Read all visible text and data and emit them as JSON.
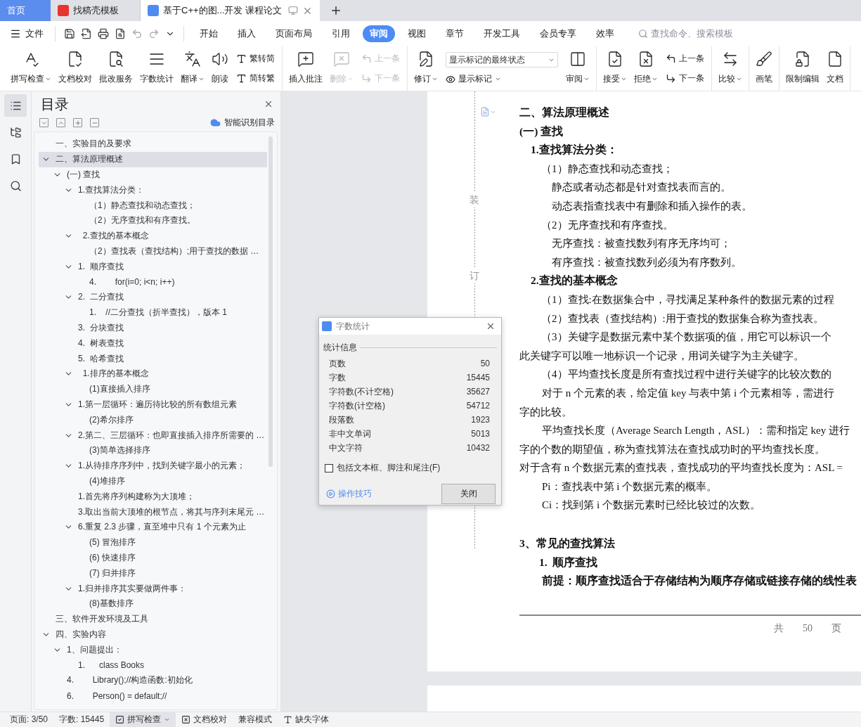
{
  "window_tabs": [
    {
      "label": "首页",
      "kind": "home",
      "selected": false
    },
    {
      "label": "找稿壳模板",
      "kind": "template",
      "selected": false
    },
    {
      "label": "基于C++的图...开发 课程论文",
      "kind": "document",
      "selected": true
    }
  ],
  "menu": {
    "file": "文件",
    "tabs": [
      {
        "label": "开始",
        "selected": false
      },
      {
        "label": "插入",
        "selected": false
      },
      {
        "label": "页面布局",
        "selected": false
      },
      {
        "label": "引用",
        "selected": false
      },
      {
        "label": "审阅",
        "selected": true
      },
      {
        "label": "视图",
        "selected": false
      },
      {
        "label": "章节",
        "selected": false
      },
      {
        "label": "开发工具",
        "selected": false
      },
      {
        "label": "会员专享",
        "selected": false
      },
      {
        "label": "效率",
        "selected": false
      }
    ],
    "search": {
      "placeholder": "查找命令、搜索模板"
    }
  },
  "ribbon": {
    "groups": [
      {
        "tools": [
          {
            "kind": "large",
            "label": "拼写检查",
            "dropdown": true,
            "disabled": false
          },
          {
            "kind": "large",
            "label": "文档校对",
            "dropdown": false,
            "disabled": false
          },
          {
            "kind": "large",
            "label": "批改服务",
            "dropdown": false,
            "disabled": false
          },
          {
            "kind": "large",
            "label": "字数统计",
            "dropdown": false,
            "disabled": false
          },
          {
            "kind": "large",
            "label": "翻译",
            "dropdown": true,
            "disabled": false
          },
          {
            "kind": "large",
            "label": "朗读",
            "dropdown": false,
            "disabled": false
          },
          {
            "kind": "pair",
            "items": [
              {
                "label": "繁转简",
                "disabled": false
              },
              {
                "label": "简转繁",
                "disabled": false
              }
            ]
          }
        ]
      },
      {
        "tools": [
          {
            "kind": "large",
            "label": "插入批注",
            "dropdown": false,
            "disabled": false
          },
          {
            "kind": "large",
            "label": "删除",
            "dropdown": true,
            "disabled": true
          },
          {
            "kind": "pair",
            "items": [
              {
                "label": "上一条",
                "disabled": true
              },
              {
                "label": "下一条",
                "disabled": true
              }
            ]
          }
        ]
      },
      {
        "tools": [
          {
            "kind": "large",
            "label": "修订",
            "dropdown": true,
            "disabled": false
          },
          {
            "kind": "select",
            "value": "显示标记的最终状态",
            "label": "显示标记",
            "dropdown": true
          },
          {
            "kind": "large",
            "label": "审阅",
            "dropdown": true,
            "disabled": false
          }
        ]
      },
      {
        "tools": [
          {
            "kind": "large",
            "label": "接受",
            "dropdown": true,
            "disabled": false
          },
          {
            "kind": "large",
            "label": "拒绝",
            "dropdown": true,
            "disabled": false
          },
          {
            "kind": "pair",
            "items": [
              {
                "label": "上一条",
                "disabled": false
              },
              {
                "label": "下一条",
                "disabled": false
              }
            ]
          }
        ]
      },
      {
        "tools": [
          {
            "kind": "large",
            "label": "比较",
            "dropdown": true,
            "disabled": false
          }
        ]
      },
      {
        "tools": [
          {
            "kind": "large",
            "label": "画笔",
            "dropdown": false,
            "disabled": false
          }
        ]
      },
      {
        "tools": [
          {
            "kind": "large",
            "label": "限制编辑",
            "dropdown": false,
            "disabled": false
          },
          {
            "kind": "large",
            "label": "文档",
            "dropdown": false,
            "disabled": false
          }
        ]
      }
    ]
  },
  "side_rail": [
    {
      "selected": true
    },
    {
      "selected": false
    },
    {
      "selected": false
    },
    {
      "selected": false
    }
  ],
  "toc": {
    "title": "目录",
    "smart_button": "智能识别目录",
    "items": [
      {
        "text": "一、实验目的及要求",
        "selected": false
      },
      {
        "text": "二、算法原理概述",
        "selected": true,
        "expanded": true,
        "children": [
          {
            "text": "(一) 查找",
            "selected": false,
            "expanded": true,
            "children": [
              {
                "text": "1.查找算法分类：",
                "selected": false,
                "expanded": true,
                "children": [
                  {
                    "text": "（1）静态查找和动态查找；",
                    "selected": false
                  },
                  {
                    "text": "（2）无序查找和有序查找。",
                    "selected": false
                  }
                ]
              },
              {
                "text": "  2.查找的基本概念",
                "selected": false,
                "expanded": true,
                "children": [
                  {
                    "text": "（2）查找表（查找结构）;用于查找的数据 …",
                    "selected": false
                  }
                ]
              },
              {
                "text": "1.  顺序查找",
                "selected": false,
                "expanded": true,
                "children": [
                  {
                    "text": "4.        for(i=0; i<n; i++)",
                    "selected": false
                  }
                ]
              },
              {
                "text": "2.  二分查找",
                "selected": false,
                "expanded": true,
                "children": [
                  {
                    "text": "1.    //二分查找（折半查找），版本 1",
                    "selected": false
                  }
                ]
              },
              {
                "text": "3.  分块查找",
                "selected": false
              },
              {
                "text": "4.  树表查找",
                "selected": false
              },
              {
                "text": "5.  哈希查找",
                "selected": false
              },
              {
                "text": "  1.排序的基本概念",
                "selected": false,
                "expanded": true,
                "children": [
                  {
                    "text": "(1)直接插入排序",
                    "selected": false
                  }
                ]
              },
              {
                "text": "1.第一层循环：遍历待比较的所有数组元素",
                "selected": false,
                "expanded": true,
                "children": [
                  {
                    "text": "(2)希尔排序",
                    "selected": false
                  }
                ]
              },
              {
                "text": "2.第二、三层循环：也即直接插入排序所需要的 …",
                "selected": false,
                "expanded": true,
                "children": [
                  {
                    "text": "(3)简单选择排序",
                    "selected": false
                  }
                ]
              },
              {
                "text": "1.从待排序序列中，找到关键字最小的元素；",
                "selected": false,
                "expanded": true,
                "children": [
                  {
                    "text": "(4)堆排序",
                    "selected": false
                  }
                ]
              },
              {
                "text": "1.首先将序列构建称为大顶堆；",
                "selected": false
              },
              {
                "text": "3.取出当前大顶堆的根节点，将其与序列末尾元 …",
                "selected": false
              },
              {
                "text": "6.重复 2.3 步骤，直至堆中只有 1 个元素为止",
                "selected": false,
                "expanded": true,
                "children": [
                  {
                    "text": "(5) 冒泡排序",
                    "selected": false
                  },
                  {
                    "text": "(6) 快速排序",
                    "selected": false
                  },
                  {
                    "text": "(7) 归并排序",
                    "selected": false
                  }
                ]
              },
              {
                "text": "1.归并排序其实要做两件事：",
                "selected": false,
                "expanded": true,
                "children": [
                  {
                    "text": "(8)基数排序",
                    "selected": false
                  }
                ]
              }
            ]
          }
        ]
      },
      {
        "text": "三、软件开发环境及工具",
        "selected": false
      },
      {
        "text": "四、实验内容",
        "selected": false,
        "expanded": true,
        "children": [
          {
            "text": "1、问题提出：",
            "selected": false,
            "expanded": true,
            "children": [
              {
                "text": "1.      class Books",
                "selected": false
              }
            ]
          },
          {
            "text": "4.        Library();//构造函数:初始化",
            "selected": false
          },
          {
            "text": "6.        Person() = default;//",
            "selected": false
          }
        ]
      }
    ]
  },
  "document": {
    "binding_marks": [
      "装",
      "订"
    ],
    "paragraphs": [
      {
        "kind": "h1",
        "text": "二、算法原理概述"
      },
      {
        "kind": "h1",
        "text": "(一) 查找"
      },
      {
        "kind": "h3",
        "text": "1.查找算法分类："
      },
      {
        "kind": "item",
        "text": "（1）静态查找和动态查找；"
      },
      {
        "kind": "detail",
        "text": "静态或者动态都是针对查找表而言的。"
      },
      {
        "kind": "detail",
        "text": "动态表指查找表中有删除和插入操作的表。"
      },
      {
        "kind": "item",
        "text": "（2）无序查找和有序查找。"
      },
      {
        "kind": "detail",
        "text": "无序查找：被查找数列有序无序均可；"
      },
      {
        "kind": "detail",
        "text": "有序查找：被查找数列必须为有序数列。"
      },
      {
        "kind": "h3",
        "text": "2.查找的基本概念"
      },
      {
        "kind": "item",
        "text": "（1）查找:在数据集合中，寻找满足某种条件的数据元素的过程"
      },
      {
        "kind": "item",
        "text": "（2）查找表（查找结构）:用于查找的数据集合称为查找表。"
      },
      {
        "kind": "item",
        "text": "（3）关键字是数据元素中某个数据项的值，用它可以标识一个"
      },
      {
        "kind": "cont",
        "text": "此关键字可以唯一地标识一个记录，用词关键字为主关键字。"
      },
      {
        "kind": "item",
        "text": "（4）平均查找长度是所有查找过程中进行关键字的比较次数的"
      },
      {
        "kind": "para",
        "text": "对于 n 个元素的表，给定值 key 与表中第 i 个元素相等，需进行"
      },
      {
        "kind": "cont",
        "text": "字的比较。"
      },
      {
        "kind": "para",
        "text": "平均查找长度（Average Search Length，ASL）：需和指定 key 进行"
      },
      {
        "kind": "cont",
        "text": "字的个数的期望值，称为查找算法在查找成功时的平均查找长度。"
      },
      {
        "kind": "cont",
        "text": "对于含有 n 个数据元素的查找表，查找成功的平均查找长度为：ASL ="
      },
      {
        "kind": "para",
        "text": "Pi：查找表中第 i 个数据元素的概率。"
      },
      {
        "kind": "para",
        "text": "Ci：找到第 i 个数据元素时已经比较过的次数。"
      },
      {
        "kind": "section",
        "text": "3、常见的查找算法"
      },
      {
        "kind": "h4",
        "text": "1.  顺序查找"
      },
      {
        "kind": "lead",
        "text": "前提：顺序查找适合于存储结构为顺序存储或链接存储的线性表"
      }
    ],
    "footer": "共  50  页"
  },
  "dialog": {
    "title": "字数统计",
    "section": "统计信息",
    "stats": [
      {
        "label": "页数",
        "value": "50"
      },
      {
        "label": "字数",
        "value": "15445"
      },
      {
        "label": "字符数(不计空格)",
        "value": "35627"
      },
      {
        "label": "字符数(计空格)",
        "value": "54712"
      },
      {
        "label": "段落数",
        "value": "1923"
      },
      {
        "label": "非中文单词",
        "value": "5013"
      },
      {
        "label": "中文字符",
        "value": "10432"
      }
    ],
    "checkbox": {
      "label": "包括文本框、脚注和尾注(F)",
      "checked": false
    },
    "link": "操作技巧",
    "button": "关闭"
  },
  "status_bar": [
    {
      "kind": "text",
      "label": "页面: 3/50",
      "highlighted": false
    },
    {
      "kind": "text",
      "label": "字数: 15445",
      "highlighted": false
    },
    {
      "kind": "spell",
      "label": "拼写检查",
      "highlighted": true
    },
    {
      "kind": "proof",
      "label": "文档校对",
      "highlighted": false
    },
    {
      "kind": "text",
      "label": "兼容模式",
      "highlighted": false
    },
    {
      "kind": "font",
      "label": "缺失字体",
      "highlighted": false
    }
  ]
}
